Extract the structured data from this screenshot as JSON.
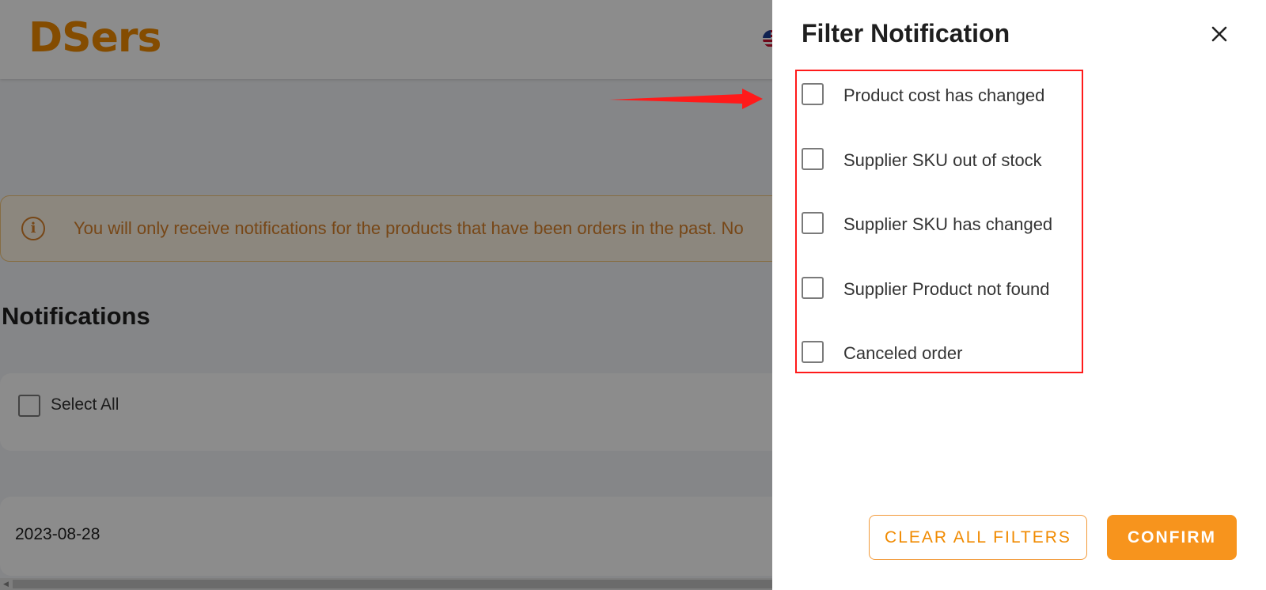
{
  "app": {
    "logo_text": "DSers",
    "brand_color": "#f08a00"
  },
  "notice": {
    "icon": "info-circle-icon",
    "text": "You will only receive notifications for the products that have been orders in the past. No"
  },
  "page": {
    "title": "Notifications",
    "select_all_label": "Select All",
    "date": "2023-08-28"
  },
  "drawer": {
    "title": "Filter Notification",
    "close_icon": "close-icon",
    "options": [
      {
        "label": "Product cost has changed",
        "checked": false
      },
      {
        "label": "Supplier SKU out of stock",
        "checked": false
      },
      {
        "label": "Supplier SKU has changed",
        "checked": false
      },
      {
        "label": "Supplier Product not found",
        "checked": false
      },
      {
        "label": "Canceled order",
        "checked": false
      }
    ],
    "clear_label": "CLEAR ALL FILTERS",
    "confirm_label": "CONFIRM",
    "accent_color": "#f7941d",
    "highlight_color": "#ff1a1a"
  }
}
